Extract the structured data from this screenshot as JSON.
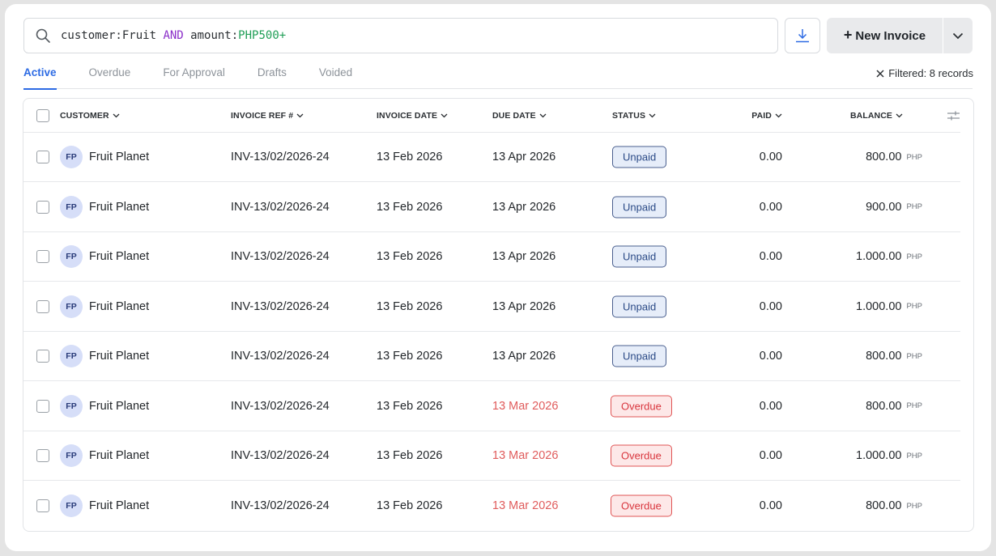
{
  "search": {
    "query_parts": [
      {
        "text": "customer:Fruit ",
        "kind": "plain"
      },
      {
        "text": "AND",
        "kind": "keyword"
      },
      {
        "text": " amount:",
        "kind": "plain"
      },
      {
        "text": "PHP500+",
        "kind": "value"
      }
    ],
    "icon": "search-icon"
  },
  "toolbar": {
    "download_icon": "download-icon",
    "new_invoice_label": "New Invoice",
    "new_invoice_plus": "+",
    "dropdown_icon": "chevron-down-icon"
  },
  "tabs": [
    {
      "label": "Active",
      "active": true
    },
    {
      "label": "Overdue",
      "active": false
    },
    {
      "label": "For Approval",
      "active": false
    },
    {
      "label": "Drafts",
      "active": false
    },
    {
      "label": "Voided",
      "active": false
    }
  ],
  "filter": {
    "clear_icon": "close-icon",
    "label": "Filtered: 8 records"
  },
  "table": {
    "columns": [
      {
        "key": "customer",
        "label": "CUSTOMER"
      },
      {
        "key": "ref",
        "label": "INVOICE REF #"
      },
      {
        "key": "invoice_date",
        "label": "INVOICE DATE"
      },
      {
        "key": "due_date",
        "label": "DUE DATE"
      },
      {
        "key": "status",
        "label": "STATUS"
      },
      {
        "key": "paid",
        "label": "PAID"
      },
      {
        "key": "balance",
        "label": "BALANCE"
      }
    ],
    "settings_icon": "sliders-icon",
    "currency": "PHP",
    "rows": [
      {
        "initials": "FP",
        "customer": "Fruit Planet",
        "ref": "INV-13/02/2026-24",
        "invoice_date": "13 Feb 2026",
        "due_date": "13 Apr 2026",
        "status": "Unpaid",
        "paid": "0.00",
        "balance": "800.00"
      },
      {
        "initials": "FP",
        "customer": "Fruit Planet",
        "ref": "INV-13/02/2026-24",
        "invoice_date": "13 Feb 2026",
        "due_date": "13 Apr 2026",
        "status": "Unpaid",
        "paid": "0.00",
        "balance": "900.00"
      },
      {
        "initials": "FP",
        "customer": "Fruit Planet",
        "ref": "INV-13/02/2026-24",
        "invoice_date": "13 Feb 2026",
        "due_date": "13 Apr 2026",
        "status": "Unpaid",
        "paid": "0.00",
        "balance": "1.000.00"
      },
      {
        "initials": "FP",
        "customer": "Fruit Planet",
        "ref": "INV-13/02/2026-24",
        "invoice_date": "13 Feb 2026",
        "due_date": "13 Apr 2026",
        "status": "Unpaid",
        "paid": "0.00",
        "balance": "1.000.00"
      },
      {
        "initials": "FP",
        "customer": "Fruit Planet",
        "ref": "INV-13/02/2026-24",
        "invoice_date": "13 Feb 2026",
        "due_date": "13 Apr 2026",
        "status": "Unpaid",
        "paid": "0.00",
        "balance": "800.00"
      },
      {
        "initials": "FP",
        "customer": "Fruit Planet",
        "ref": "INV-13/02/2026-24",
        "invoice_date": "13 Feb 2026",
        "due_date": "13 Mar 2026",
        "status": "Overdue",
        "paid": "0.00",
        "balance": "800.00"
      },
      {
        "initials": "FP",
        "customer": "Fruit Planet",
        "ref": "INV-13/02/2026-24",
        "invoice_date": "13 Feb 2026",
        "due_date": "13 Mar 2026",
        "status": "Overdue",
        "paid": "0.00",
        "balance": "1.000.00"
      },
      {
        "initials": "FP",
        "customer": "Fruit Planet",
        "ref": "INV-13/02/2026-24",
        "invoice_date": "13 Feb 2026",
        "due_date": "13 Mar 2026",
        "status": "Overdue",
        "paid": "0.00",
        "balance": "800.00"
      }
    ]
  },
  "colors": {
    "accent": "#2d6be4",
    "unpaid_border": "#4a5f8e",
    "overdue": "#e05555",
    "query_keyword": "#8b2fc9",
    "query_value": "#1f9e56"
  }
}
